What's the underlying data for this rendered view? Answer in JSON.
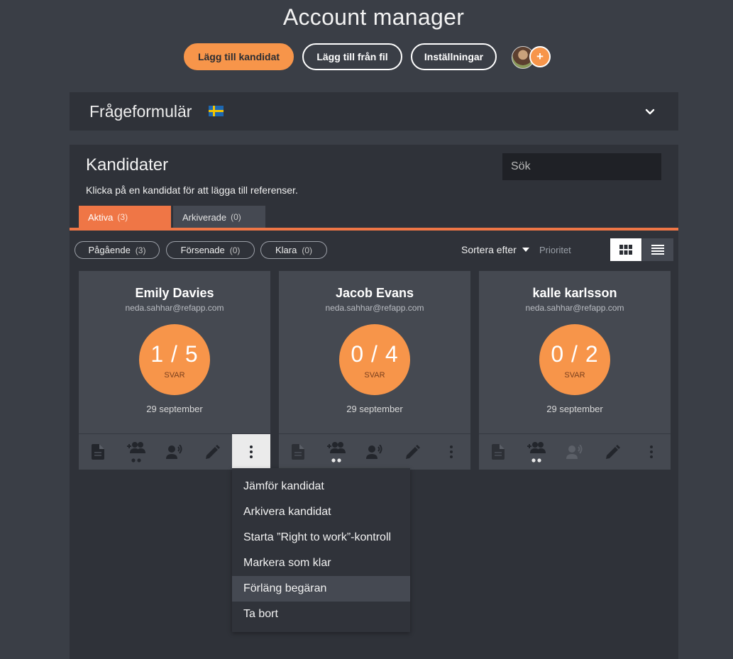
{
  "app_title": "Account manager",
  "top_buttons": {
    "add_candidate": "Lägg till kandidat",
    "add_from_file": "Lägg till från fil",
    "settings": "Inställningar"
  },
  "avatar_add_symbol": "+",
  "questionnaire": {
    "title": "Frågeformulär",
    "flag_icon": "sweden-flag",
    "chevron_icon": "chevron-down-icon"
  },
  "candidates_section": {
    "title": "Kandidater",
    "subtitle": "Klicka på en kandidat för att lägga till referenser.",
    "search_placeholder": "Sök",
    "tabs": [
      {
        "label": "Aktiva",
        "count": "(3)"
      },
      {
        "label": "Arkiverade",
        "count": "(0)"
      }
    ],
    "filters": [
      {
        "label": "Pågående",
        "count": "(3)"
      },
      {
        "label": "Försenade",
        "count": "(0)"
      },
      {
        "label": "Klara",
        "count": "(0)"
      }
    ],
    "sort_label": "Sortera efter",
    "sort_value": "Prioritet"
  },
  "cards": [
    {
      "name": "Emily Davies",
      "email": "neda.sahhar@refapp.com",
      "fraction": "1 / 5",
      "answers_label": "SVAR",
      "date": "29 september"
    },
    {
      "name": "Jacob Evans",
      "email": "neda.sahhar@refapp.com",
      "fraction": "0 / 4",
      "answers_label": "SVAR",
      "date": "29 september"
    },
    {
      "name": "kalle karlsson",
      "email": "neda.sahhar@refapp.com",
      "fraction": "0 / 2",
      "answers_label": "SVAR",
      "date": "29 september"
    }
  ],
  "card_icons": [
    "document-icon",
    "add-references-icon",
    "voice-call-icon",
    "pencil-icon",
    "more-vert-icon"
  ],
  "context_menu": [
    "Jämför kandidat",
    "Arkivera kandidat",
    "Starta ”Right to work”-kontroll",
    "Markera som klar",
    "Förläng begäran",
    "Ta bort"
  ],
  "colors": {
    "accent": "#f7954a",
    "tab_accent": "#ef7646",
    "background": "#3a3e46",
    "panel": "#2f3239",
    "card": "#454951"
  }
}
